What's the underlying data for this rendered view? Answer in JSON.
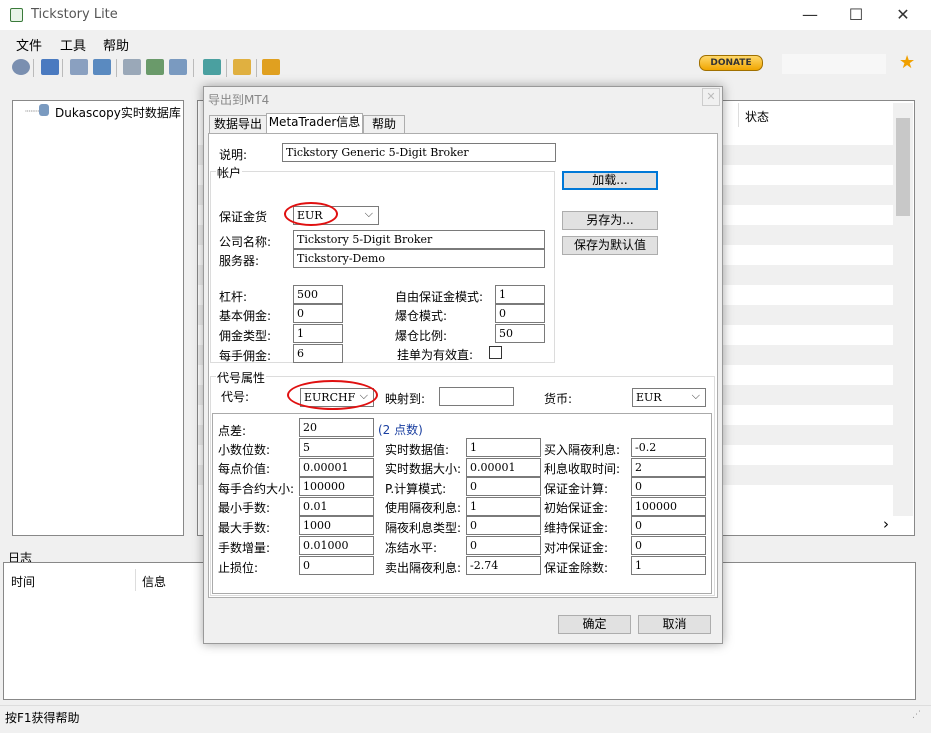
{
  "window": {
    "title": "Tickstory Lite",
    "min": "—",
    "max": "☐",
    "close": "✕"
  },
  "menu": [
    "文件",
    "工具",
    "帮助"
  ],
  "toolbar": {
    "donate": "DONATE",
    "star": "★"
  },
  "tree": {
    "root": "Dukascopy实时数据库"
  },
  "grid": {
    "col_status": "状态",
    "scroll_up": "︿",
    "scroll_down": "﹀",
    "scroll_right": "›"
  },
  "log": {
    "title": "日志",
    "col_time": "时间",
    "col_info": "信息"
  },
  "status_bar": "按F1获得帮助",
  "dialog": {
    "title": "导出到MT4",
    "close": "✕",
    "tabs": [
      "数据导出",
      "MetaTrader信息",
      "帮助"
    ],
    "desc_label": "说明:",
    "desc_value": "Tickstory Generic 5-Digit Broker",
    "account_group": "帐户",
    "margin_currency_label": "保证金货",
    "margin_currency": "EUR",
    "company_label": "公司名称:",
    "company": "Tickstory 5-Digit Broker",
    "server_label": "服务器:",
    "server": "Tickstory-Demo",
    "leverage_label": "杠杆:",
    "leverage": "500",
    "base_comm_label": "基本佣金:",
    "base_comm": "0",
    "comm_type_label": "佣金类型:",
    "comm_type": "1",
    "lot_comm_label": "每手佣金:",
    "lot_comm": "6",
    "free_margin_mode_label": "自由保证金模式:",
    "free_margin_mode": "1",
    "stopout_mode_label": "爆仓模式:",
    "stopout_mode": "0",
    "stopout_ratio_label": "爆仓比例:",
    "stopout_ratio": "50",
    "pending_valid_label": "挂单为有效直:",
    "btn_load": "加载...",
    "btn_saveas": "另存为...",
    "btn_default": "保存为默认值",
    "symbol_group": "代号属性",
    "symbol_label": "代号:",
    "symbol": "EURCHF",
    "map_label": "映射到:",
    "map_value": "",
    "currency_label": "货币:",
    "currency": "EUR",
    "col1": [
      {
        "label": "点差:",
        "value": "20"
      },
      {
        "label": "小数位数:",
        "value": "5"
      },
      {
        "label": "每点价值:",
        "value": "0.00001"
      },
      {
        "label": "每手合约大小:",
        "value": "100000"
      },
      {
        "label": "最小手数:",
        "value": "0.01"
      },
      {
        "label": "最大手数:",
        "value": "1000"
      },
      {
        "label": "手数增量:",
        "value": "0.01000"
      },
      {
        "label": "止损位:",
        "value": "0"
      }
    ],
    "spread_note": "(2 点数)",
    "col2": [
      {
        "label": "实时数据值:",
        "value": "1"
      },
      {
        "label": "实时数据大小:",
        "value": "0.00001"
      },
      {
        "label": "P.计算模式:",
        "value": "0"
      },
      {
        "label": "使用隔夜利息:",
        "value": "1"
      },
      {
        "label": "隔夜利息类型:",
        "value": "0"
      },
      {
        "label": "冻结水平:",
        "value": "0"
      },
      {
        "label": "卖出隔夜利息:",
        "value": "-2.74"
      }
    ],
    "col3": [
      {
        "label": "买入隔夜利息:",
        "value": "-0.2"
      },
      {
        "label": "利息收取时间:",
        "value": "2"
      },
      {
        "label": "保证金计算:",
        "value": "0"
      },
      {
        "label": "初始保证金:",
        "value": "100000"
      },
      {
        "label": "维持保证金:",
        "value": "0"
      },
      {
        "label": "对冲保证金:",
        "value": "0"
      },
      {
        "label": "保证金除数:",
        "value": "1"
      }
    ],
    "btn_ok": "确定",
    "btn_cancel": "取消"
  }
}
